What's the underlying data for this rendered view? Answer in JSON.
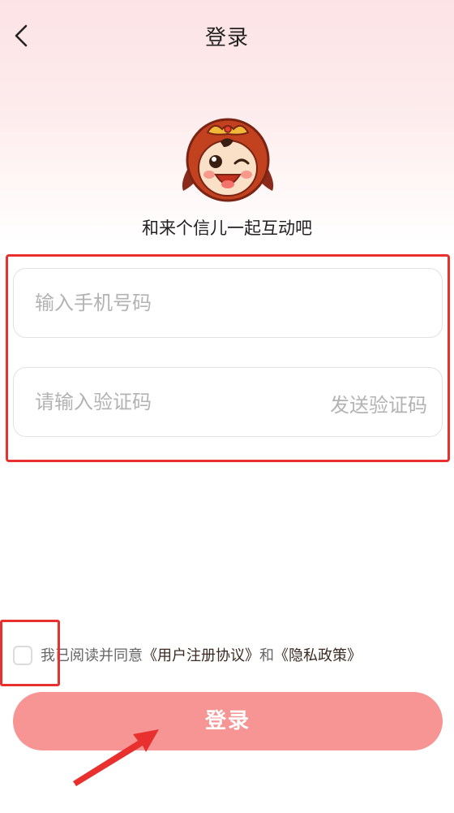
{
  "header": {
    "title": "登录"
  },
  "intro": {
    "tagline": "和来个信儿一起互动吧"
  },
  "form": {
    "phone_placeholder": "输入手机号码",
    "code_placeholder": "请输入验证码",
    "send_code_label": "发送验证码"
  },
  "agreement": {
    "prefix": "我已阅读并同意",
    "user_agreement": "《用户注册协议》",
    "and": "和",
    "privacy_policy": "《隐私政策》"
  },
  "login_button": {
    "label": "登录"
  },
  "colors": {
    "accent": "#f69593",
    "annotation": "#e8302f"
  }
}
